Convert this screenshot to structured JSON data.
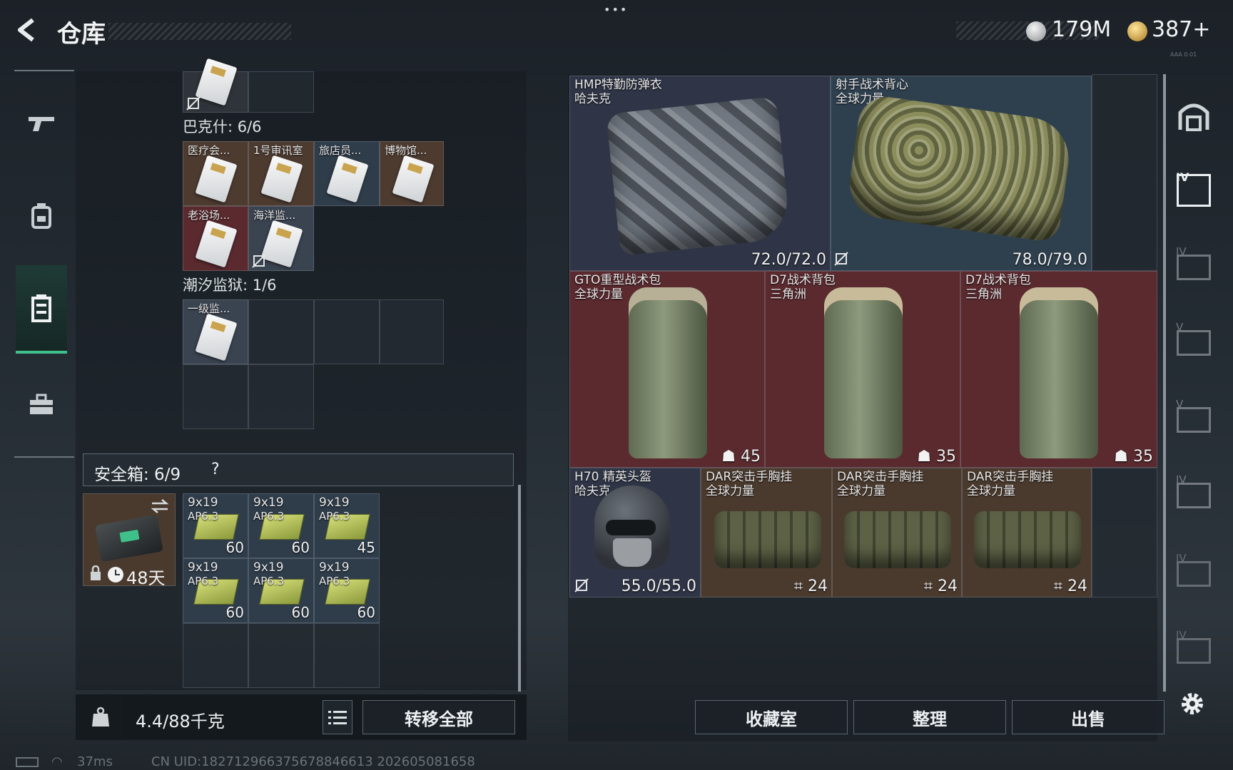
{
  "header": {
    "back_icon": "chevron-left-icon",
    "title": "仓库",
    "more_dots": "•••",
    "currency1": {
      "icon": "silver-coin-icon",
      "value": "179M"
    },
    "currency2": {
      "icon": "gold-coin-icon",
      "value": "387+"
    },
    "tiny_text": "AAA 0.01"
  },
  "sidebar": {
    "items": [
      {
        "name": "weapon-icon",
        "active": false
      },
      {
        "name": "backpack-icon",
        "active": false
      },
      {
        "name": "locker-icon",
        "active": true
      },
      {
        "name": "toolbox-icon",
        "active": false
      }
    ]
  },
  "keycards": {
    "group1": {
      "label": "巴克什: 6/6",
      "cards": [
        "医疗会...",
        "1号审讯室",
        "旅店员...",
        "博物馆...",
        "老浴场...",
        "海洋监..."
      ]
    },
    "group2": {
      "label": "潮汐监狱: 1/6",
      "cards": [
        "一级监..."
      ]
    }
  },
  "safe_box": {
    "label": "安全箱: 6/9",
    "help": "?",
    "timer": "48天",
    "ammo": [
      {
        "name": "9x19",
        "sub": "AP6.3",
        "count": "60"
      },
      {
        "name": "9x19",
        "sub": "AP6.3",
        "count": "60"
      },
      {
        "name": "9x19",
        "sub": "AP6.3",
        "count": "45"
      },
      {
        "name": "9x19",
        "sub": "AP6.3",
        "count": "60"
      },
      {
        "name": "9x19",
        "sub": "AP6.3",
        "count": "60"
      },
      {
        "name": "9x19",
        "sub": "AP6.3",
        "count": "60"
      }
    ]
  },
  "left_footer": {
    "weight": "4.4/88千克",
    "transfer_all": "转移全部"
  },
  "stash": {
    "armors": [
      {
        "name": "HMP特勤防弹衣",
        "brand": "哈夫克",
        "durability": "72.0/72.0"
      },
      {
        "name": "射手战术背心",
        "brand": "全球力量",
        "durability": "78.0/79.0"
      }
    ],
    "backpacks": [
      {
        "name": "GTO重型战术包",
        "brand": "全球力量",
        "capacity": "45"
      },
      {
        "name": "D7战术背包",
        "brand": "三角洲",
        "capacity": "35"
      },
      {
        "name": "D7战术背包",
        "brand": "三角洲",
        "capacity": "35"
      }
    ],
    "helmet": {
      "name": "H70 精英头盔",
      "brand": "哈夫克",
      "durability": "55.0/55.0"
    },
    "rigs": [
      {
        "name": "DAR突击手胸挂",
        "brand": "全球力量",
        "capacity": "24"
      },
      {
        "name": "DAR突击手胸挂",
        "brand": "全球力量",
        "capacity": "24"
      },
      {
        "name": "DAR突击手胸挂",
        "brand": "全球力量",
        "capacity": "24"
      }
    ]
  },
  "right_tabs": [
    "IV",
    "IV",
    "V",
    "V",
    "IV",
    "IV",
    "IV"
  ],
  "bottom_buttons": {
    "collection": "收藏室",
    "organize": "整理",
    "sell": "出售"
  },
  "status_bar": {
    "ping": "37ms",
    "uid": "CN UID:182712966375678846613 202605081658"
  },
  "colors": {
    "red_bg": "#5a2a2f",
    "brown_bg": "#4a3a2e",
    "blue_bg": "#2c3a48",
    "accent_green": "#3fbf8a"
  }
}
